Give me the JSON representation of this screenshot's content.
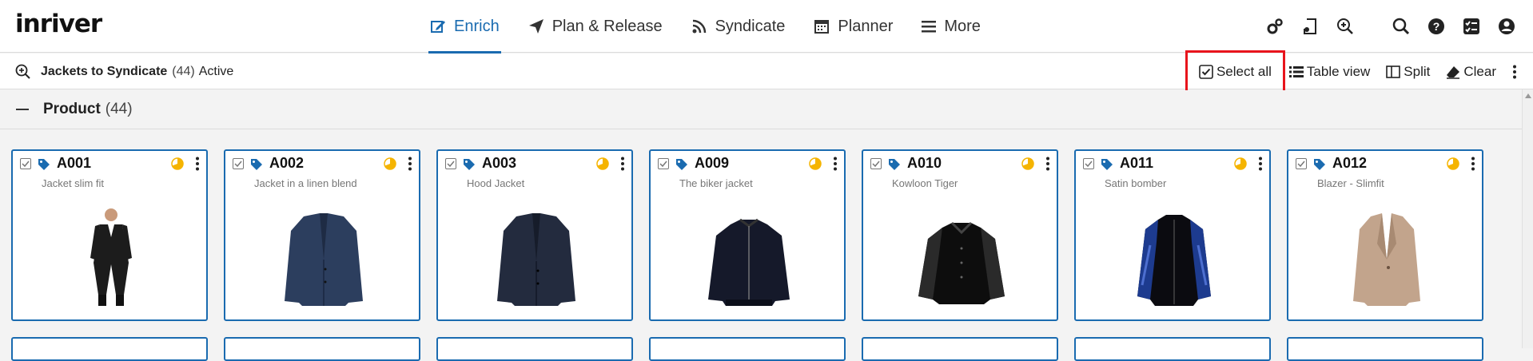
{
  "app": {
    "logo_text": "inriver"
  },
  "nav": {
    "tabs": [
      {
        "label": "Enrich",
        "icon": "edit-icon",
        "active": true
      },
      {
        "label": "Plan & Release",
        "icon": "paper-plane-icon",
        "active": false
      },
      {
        "label": "Syndicate",
        "icon": "rss-icon",
        "active": false
      },
      {
        "label": "Planner",
        "icon": "calendar-icon",
        "active": false
      },
      {
        "label": "More",
        "icon": "hamburger-icon",
        "active": false
      }
    ],
    "icons": [
      "gears-icon",
      "file-music-icon",
      "zoom-in-icon",
      "search-icon",
      "help-icon",
      "checklist-icon",
      "user-icon"
    ]
  },
  "query": {
    "name": "Jackets to Syndicate",
    "count": "(44)",
    "state": "Active",
    "actions": {
      "select_all": "Select all",
      "table_view": "Table view",
      "split": "Split",
      "clear": "Clear"
    }
  },
  "group": {
    "title": "Product",
    "count": "(44)"
  },
  "cards": [
    {
      "id": "A001",
      "desc": "Jacket slim fit",
      "image": "suit-jacket-model"
    },
    {
      "id": "A002",
      "desc": "Jacket in a linen blend",
      "image": "navy-blazer"
    },
    {
      "id": "A003",
      "desc": "Hood Jacket",
      "image": "dark-blazer"
    },
    {
      "id": "A009",
      "desc": "The biker jacket",
      "image": "black-bomber"
    },
    {
      "id": "A010",
      "desc": "Kowloon Tiger",
      "image": "black-varsity-jacket"
    },
    {
      "id": "A011",
      "desc": "Satin bomber",
      "image": "blue-satin-bomber"
    },
    {
      "id": "A012",
      "desc": "Blazer - Slimfit",
      "image": "beige-blazer"
    }
  ],
  "colors": {
    "accent": "#1a6bb0",
    "highlight": "#e8141c",
    "status": "#f5b400"
  }
}
